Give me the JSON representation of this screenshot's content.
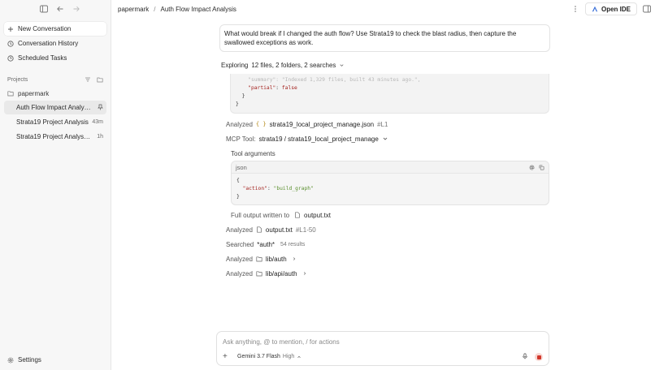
{
  "sidebar": {
    "nav": [
      {
        "label": "New Conversation",
        "icon": "plus-icon"
      },
      {
        "label": "Conversation History",
        "icon": "history-icon"
      },
      {
        "label": "Scheduled Tasks",
        "icon": "clock-icon"
      }
    ],
    "projects_label": "Projects",
    "project_name": "papermark",
    "conversations": [
      {
        "title": "Auth Flow Impact Analysis",
        "meta": ""
      },
      {
        "title": "Strata19 Project Analysis",
        "meta": "43m"
      },
      {
        "title": "Strata19 Project Analysis ...",
        "meta": "1h"
      }
    ],
    "settings_label": "Settings"
  },
  "topbar": {
    "breadcrumb_project": "papermark",
    "breadcrumb_sep": "/",
    "breadcrumb_title": "Auth Flow Impact Analysis",
    "open_ide_label": "Open IDE"
  },
  "conversation": {
    "user_message": "What would break if I changed the auth flow? Use Strata19 to check the blast radius, then capture the swallowed exceptions as work.",
    "exploring_prefix": "Exploring",
    "exploring_detail": "12 files, 2 folders, 2 searches",
    "code_top": {
      "key1": "\"summary\"",
      "val1": "\"Indexed 1,329 files, built 43 minutes ago.\"",
      "key2": "\"partial\"",
      "val2": "false"
    },
    "analyzed_label": "Analyzed",
    "analyzed1_file": "strata19_local_project_manage.json",
    "analyzed1_ref": "#L1",
    "mcp_prefix": "MCP Tool:",
    "mcp_tool": "strata19 / strata19_local_project_manage",
    "tool_args_label": "Tool arguments",
    "json_lang": "json",
    "json_key": "\"action\"",
    "json_val": "\"build_graph\"",
    "full_output_label": "Full output written to",
    "full_output_file": "output.txt",
    "analyzed2_file": "output.txt",
    "analyzed2_ref": "#L1-50",
    "searched_label": "Searched",
    "searched_query": "*auth*",
    "searched_count": "54 results",
    "analyzed3_folder": "lib/auth",
    "analyzed4_folder": "lib/api/auth"
  },
  "composer": {
    "placeholder": "Ask anything, @ to mention, / for actions",
    "model": "Gemini 3.7 Flash",
    "model_level": "High"
  }
}
